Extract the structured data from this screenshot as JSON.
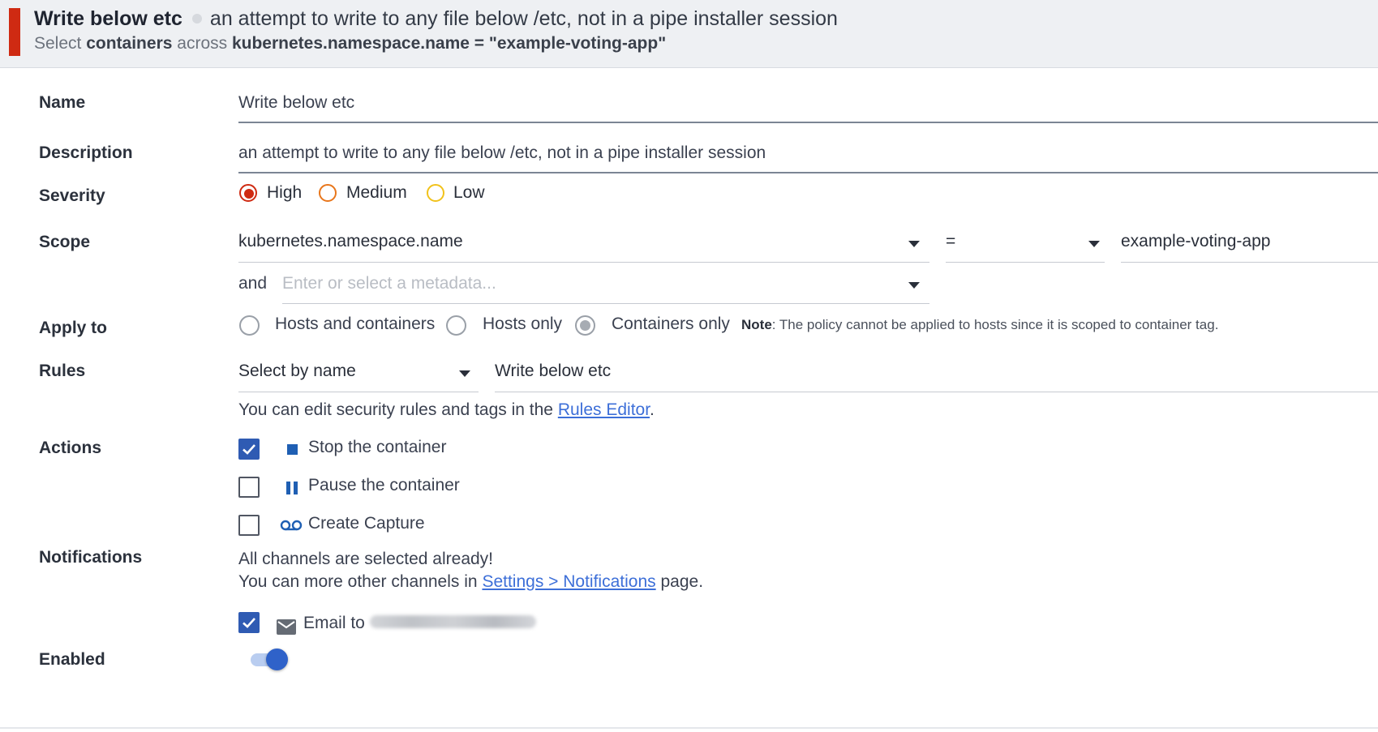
{
  "header": {
    "title": "Write below etc",
    "description": "an attempt to write to any file below /etc, not in a pipe installer session",
    "subtitle_select": "Select",
    "subtitle_containers": "containers",
    "subtitle_across": "across",
    "subtitle_scope": "kubernetes.namespace.name = \"example-voting-app\"",
    "accent_color": "#cf2a12"
  },
  "form": {
    "name": {
      "label": "Name",
      "value": "Write below etc"
    },
    "description": {
      "label": "Description",
      "value": "an attempt to write to any file below /etc, not in a pipe installer session"
    },
    "severity": {
      "label": "Severity",
      "options": [
        "High",
        "Medium",
        "Low"
      ],
      "selected": "High",
      "colors": {
        "High": "#cf2a12",
        "Medium": "#e8761b",
        "Low": "#f1c21b"
      }
    },
    "scope": {
      "label": "Scope",
      "key": "kubernetes.namespace.name",
      "operator": "=",
      "value": "example-voting-app",
      "and_label": "and",
      "placeholder": "Enter or select a metadata..."
    },
    "apply_to": {
      "label": "Apply to",
      "options": [
        "Hosts and containers",
        "Hosts only",
        "Containers only"
      ],
      "selected": "Containers only",
      "note_label": "Note",
      "note_text": ": The policy cannot be applied to hosts since it is scoped to container tag."
    },
    "rules": {
      "label": "Rules",
      "selector": "Select by name",
      "value": "Write below etc",
      "help_prefix": "You can edit security rules and tags in the",
      "help_link": "Rules Editor",
      "help_suffix": "."
    },
    "actions": {
      "label": "Actions",
      "items": [
        {
          "label": "Stop the container",
          "checked": true,
          "icon": "stop-icon"
        },
        {
          "label": "Pause the container",
          "checked": false,
          "icon": "pause-icon"
        },
        {
          "label": "Create Capture",
          "checked": false,
          "icon": "capture-icon"
        }
      ]
    },
    "notifications": {
      "label": "Notifications",
      "line1": "All channels are selected already!",
      "line2_prefix": "You can more other channels in",
      "line2_link": "Settings > Notifications",
      "line2_suffix": "page.",
      "email_label": "Email to",
      "email_checked": true,
      "email_icon": "mail-icon"
    },
    "enabled": {
      "label": "Enabled",
      "on": true
    }
  }
}
